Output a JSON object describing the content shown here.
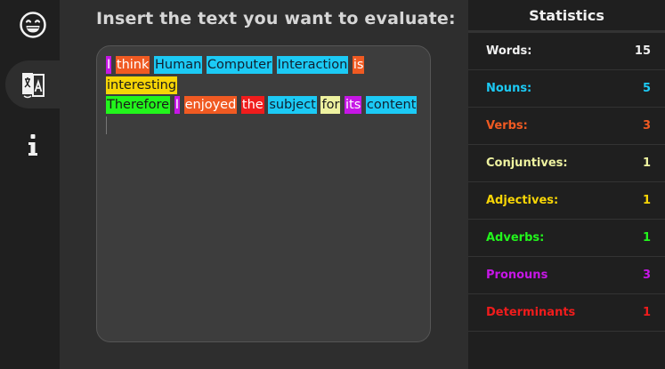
{
  "sidebar": {
    "items": [
      {
        "icon": "emoji-smile-icon",
        "active": false
      },
      {
        "icon": "translate-icon",
        "active": true
      },
      {
        "icon": "info-icon",
        "active": false
      }
    ]
  },
  "main": {
    "prompt": "Insert the text you want to evaluate:",
    "lines": [
      [
        {
          "text": "I",
          "color": "#c616e6"
        },
        {
          "text": "think",
          "color": "#f05a22"
        },
        {
          "text": "Human",
          "color": "#1ccaf5"
        },
        {
          "text": "Computer",
          "color": "#1ccaf5"
        },
        {
          "text": "Interaction",
          "color": "#1ccaf5"
        },
        {
          "text": "is",
          "color": "#f05a22"
        }
      ],
      [
        {
          "text": "interesting",
          "color": "#f7d506"
        }
      ],
      [
        {
          "text": "Therefore",
          "color": "#22f51c"
        },
        {
          "text": "I",
          "color": "#c616e6"
        },
        {
          "text": "enjoyed",
          "color": "#f05a22"
        },
        {
          "text": "the",
          "color": "#f01c1c"
        },
        {
          "text": "subject",
          "color": "#1ccaf5"
        },
        {
          "text": "for",
          "color": "#eef2a0"
        },
        {
          "text": "its",
          "color": "#c616e6"
        },
        {
          "text": "content",
          "color": "#1ccaf5"
        }
      ]
    ]
  },
  "stats": {
    "title": "Statistics",
    "rows": [
      {
        "label": "Words:",
        "value": "15",
        "color": "#f0f0f0"
      },
      {
        "label": "Nouns:",
        "value": "5",
        "color": "#1ccaf5"
      },
      {
        "label": "Verbs:",
        "value": "3",
        "color": "#f05a22"
      },
      {
        "label": "Conjuntives:",
        "value": "1",
        "color": "#eef2a0"
      },
      {
        "label": "Adjectives:",
        "value": "1",
        "color": "#f7d506"
      },
      {
        "label": "Adverbs:",
        "value": "1",
        "color": "#22f51c"
      },
      {
        "label": "Pronouns",
        "value": "3",
        "color": "#c616e6"
      },
      {
        "label": "Determinants",
        "value": "1",
        "color": "#f01c1c"
      }
    ]
  }
}
